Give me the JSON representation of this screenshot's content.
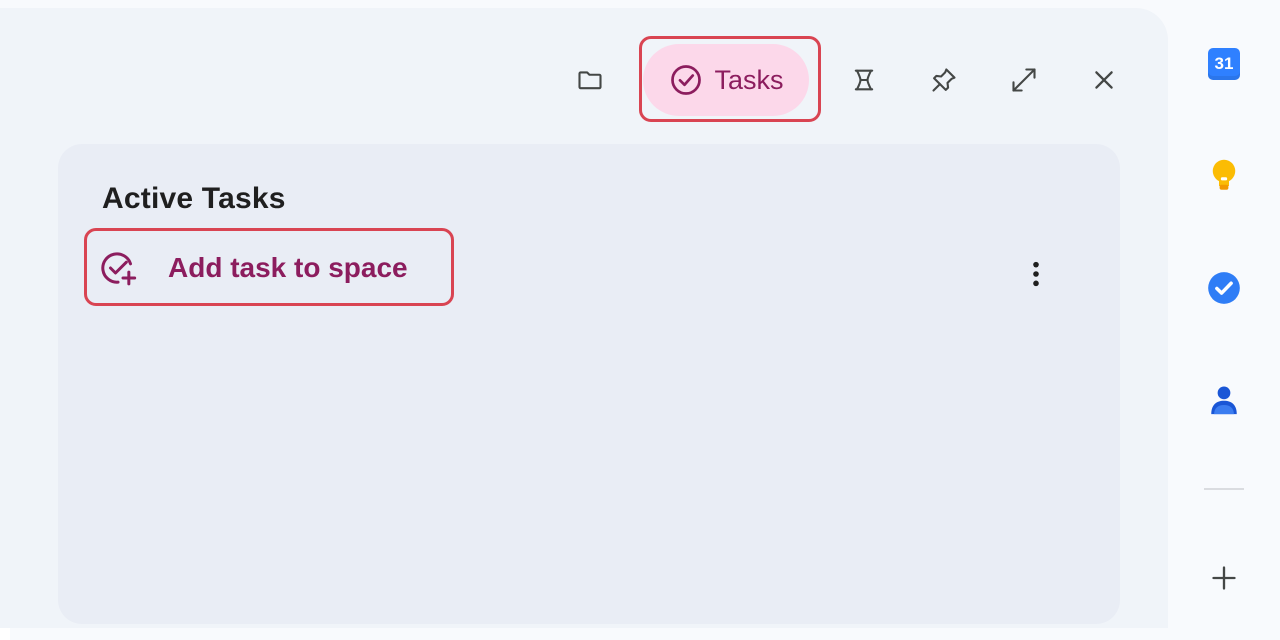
{
  "panel": {
    "tasks_tab": {
      "label": "Tasks",
      "icon": "check-circle-icon"
    },
    "toolbar_icons": [
      "folder-icon",
      "scroll-icon",
      "pin-icon",
      "expand-icon",
      "close-icon"
    ],
    "section_title": "Active Tasks",
    "add_task": {
      "label": "Add task to space",
      "icon": "add-task-icon"
    },
    "more_icon": "more-vert-icon"
  },
  "side_rail": {
    "calendar": {
      "day": "31",
      "icon": "calendar-icon"
    },
    "items": [
      "keep-icon",
      "tasks-icon",
      "contacts-icon"
    ],
    "add_icon": "plus-icon"
  },
  "colors": {
    "accent": "#8c1d5e",
    "chip_bg": "#fcd8ea",
    "highlight": "#d94452",
    "panel_bg": "#f0f4f9",
    "content_bg": "#e9edf5"
  }
}
